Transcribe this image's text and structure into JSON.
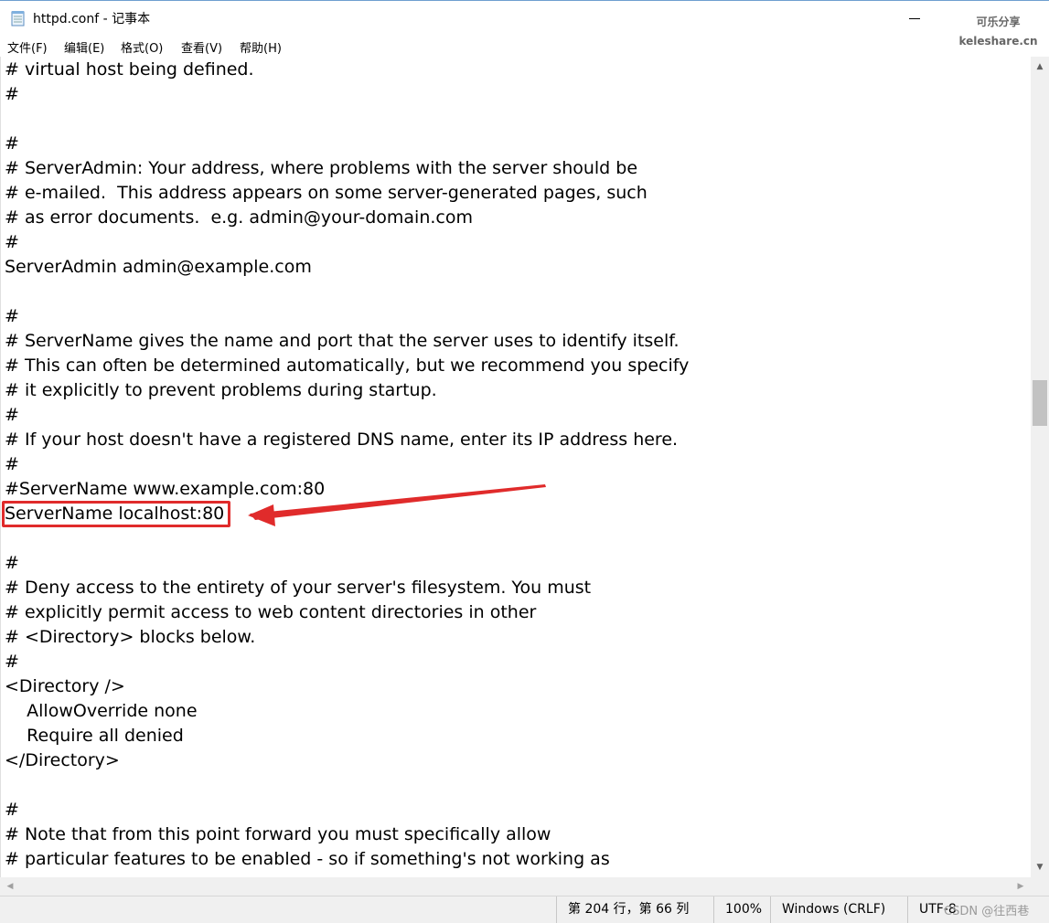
{
  "window": {
    "title": "httpd.conf - 记事本",
    "icon": "notepad-icon"
  },
  "watermark": {
    "site_name": "可乐分享",
    "site_url": "keleshare.cn",
    "author": "CSDN @往西巷"
  },
  "menu": [
    {
      "label": "文件(F)"
    },
    {
      "label": "编辑(E)"
    },
    {
      "label": "格式(O)"
    },
    {
      "label": "查看(V)"
    },
    {
      "label": "帮助(H)"
    }
  ],
  "editor": {
    "lines": [
      "# virtual host being defined.",
      "#",
      "",
      "#",
      "# ServerAdmin: Your address, where problems with the server should be",
      "# e-mailed.  This address appears on some server-generated pages, such",
      "# as error documents.  e.g. admin@your-domain.com",
      "#",
      "ServerAdmin admin@example.com",
      "",
      "#",
      "# ServerName gives the name and port that the server uses to identify itself.",
      "# This can often be determined automatically, but we recommend you specify",
      "# it explicitly to prevent problems during startup.",
      "#",
      "# If your host doesn't have a registered DNS name, enter its IP address here.",
      "#",
      "#ServerName www.example.com:80",
      "ServerName localhost:80",
      "",
      "#",
      "# Deny access to the entirety of your server's filesystem. You must",
      "# explicitly permit access to web content directories in other",
      "# <Directory> blocks below.",
      "#",
      "<Directory />",
      "    AllowOverride none",
      "    Require all denied",
      "</Directory>",
      "",
      "#",
      "# Note that from this point forward you must specifically allow",
      "# particular features to be enabled - so if something's not working as"
    ],
    "highlighted_line_index": 18,
    "annotation_color": "#e02b2b"
  },
  "status": {
    "position": "第 204 行，第 66 列",
    "zoom": "100%",
    "line_ending": "Windows (CRLF)",
    "encoding": "UTF-8"
  }
}
